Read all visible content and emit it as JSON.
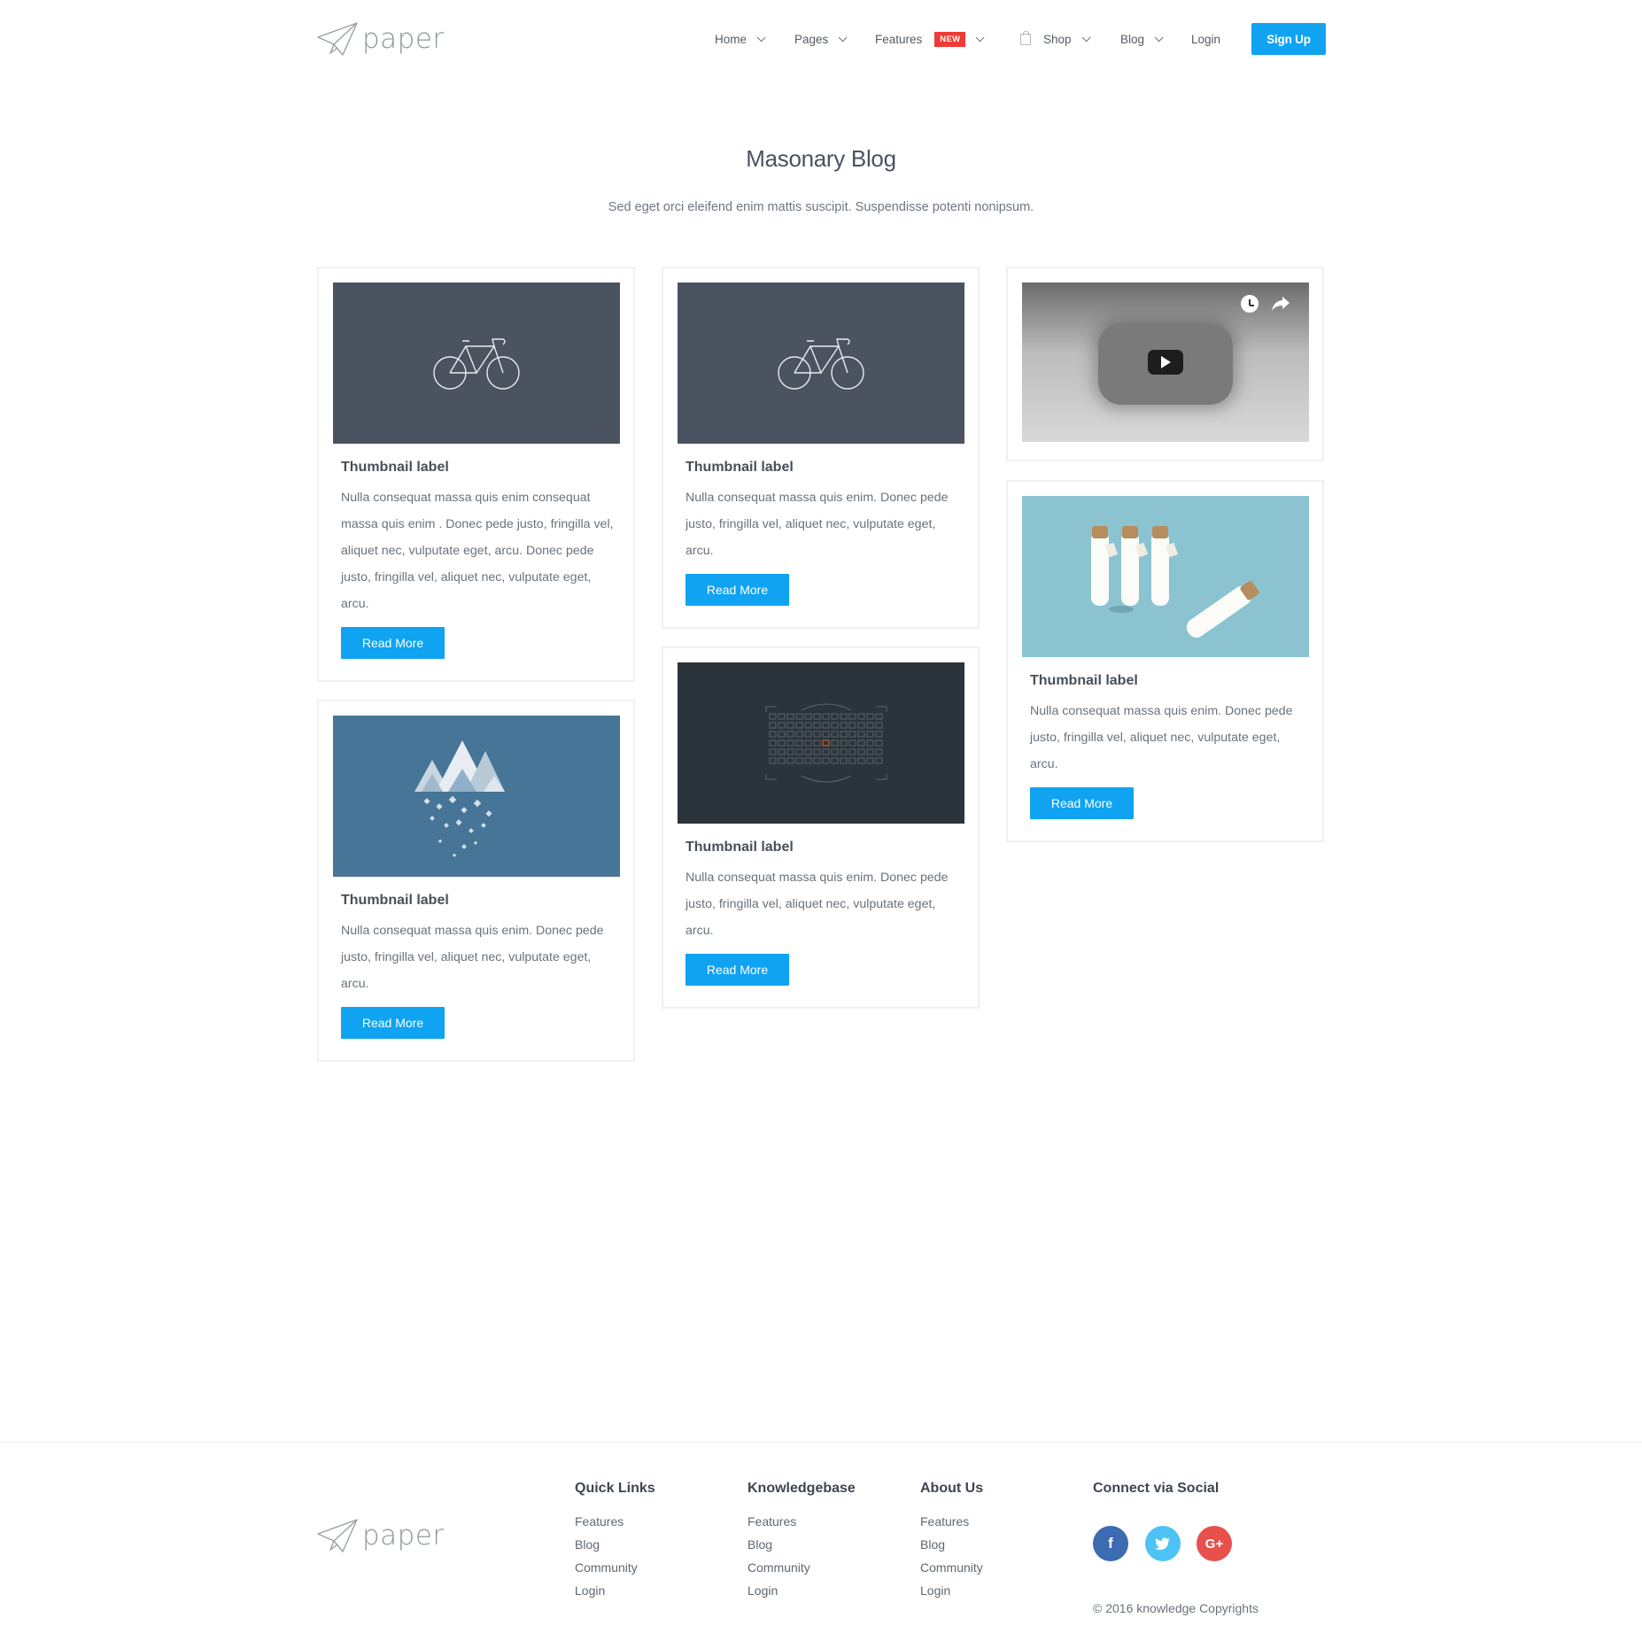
{
  "brand": {
    "name": "paper"
  },
  "nav": {
    "items": [
      {
        "label": "Home"
      },
      {
        "label": "Pages"
      },
      {
        "label": "Features",
        "badge": "NEW"
      },
      {
        "label": "Shop"
      },
      {
        "label": "Blog"
      },
      {
        "label": "Login"
      }
    ],
    "signup_label": "Sign Up"
  },
  "hero": {
    "title": "Masonary Blog",
    "subtitle": "Sed eget orci eleifend enim mattis suscipit. Suspendisse potenti nonipsum."
  },
  "cards": [
    {
      "image": "bicycle",
      "title": "Thumbnail label",
      "text": "Nulla consequat massa quis enim consequat massa quis enim . Donec pede justo, fringilla vel, aliquet nec, vulputate eget, arcu. Donec pede justo, fringilla vel, aliquet nec, vulputate eget, arcu.",
      "button": "Read More"
    },
    {
      "image": "bicycle",
      "title": "Thumbnail label",
      "text": "Nulla consequat massa quis enim. Donec pede justo, fringilla vel, aliquet nec, vulputate eget, arcu.",
      "button": "Read More"
    },
    {
      "image": "video"
    },
    {
      "image": "bottles",
      "title": "Thumbnail label",
      "text": "Nulla consequat massa quis enim. Donec pede justo, fringilla vel, aliquet nec, vulputate eget, arcu.",
      "button": "Read More"
    },
    {
      "image": "mountains",
      "title": "Thumbnail label",
      "text": "Nulla consequat massa quis enim. Donec pede justo, fringilla vel, aliquet nec, vulputate eget, arcu.",
      "button": "Read More"
    },
    {
      "image": "focus-grid",
      "title": "Thumbnail label",
      "text": "Nulla consequat massa quis enim. Donec pede justo, fringilla vel, aliquet nec, vulputate eget, arcu.",
      "button": "Read More"
    }
  ],
  "footer": {
    "columns": [
      {
        "heading": "Quick Links",
        "links": [
          "Features",
          "Blog",
          "Community",
          "Login"
        ]
      },
      {
        "heading": "Knowledgebase",
        "links": [
          "Features",
          "Blog",
          "Community",
          "Login"
        ]
      },
      {
        "heading": "About Us",
        "links": [
          "Features",
          "Blog",
          "Community",
          "Login"
        ]
      }
    ],
    "social": {
      "heading": "Connect via Social",
      "icons": [
        {
          "name": "facebook-icon",
          "glyph": "f",
          "color": "#3b6bb0"
        },
        {
          "name": "twitter-icon",
          "glyph": "t",
          "color": "#4dc3f5"
        },
        {
          "name": "google-plus-icon",
          "glyph": "G+",
          "color": "#e8504c"
        }
      ]
    },
    "copyright": "© 2016 knowledge Copyrights"
  },
  "colors": {
    "accent": "#0fa3f2",
    "badge": "#ef3a35",
    "thumb_slate": "#4a535f",
    "thumb_teal": "#8bc4d0",
    "thumb_blue": "#467597",
    "thumb_dark": "#2c343b"
  }
}
